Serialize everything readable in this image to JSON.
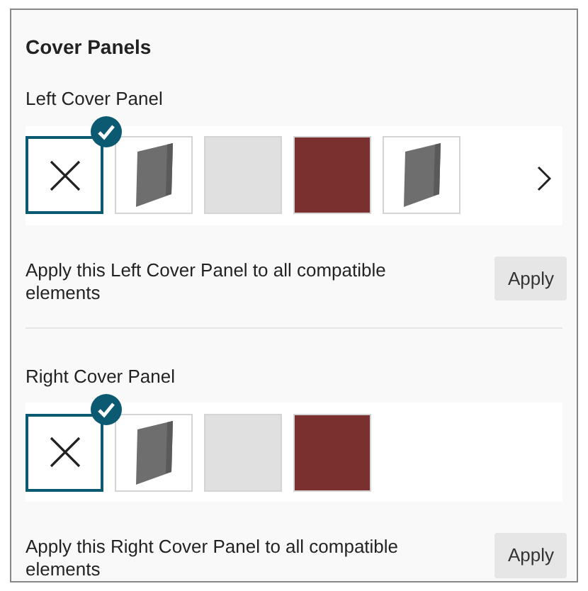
{
  "title": "Cover Panels",
  "sections": [
    {
      "label": "Left Cover Panel",
      "has_next": true,
      "options": [
        {
          "kind": "none",
          "selected": true
        },
        {
          "kind": "panel",
          "selected": false
        },
        {
          "kind": "color",
          "color": "#e0e0e0",
          "selected": false
        },
        {
          "kind": "color",
          "color": "#7b3030",
          "selected": false
        },
        {
          "kind": "panel",
          "selected": false
        }
      ],
      "apply_text": "Apply this Left Cover Panel to all compatible elements",
      "apply_button": "Apply"
    },
    {
      "label": "Right Cover Panel",
      "has_next": false,
      "options": [
        {
          "kind": "none",
          "selected": true
        },
        {
          "kind": "panel",
          "selected": false
        },
        {
          "kind": "color",
          "color": "#e0e0e0",
          "selected": false
        },
        {
          "kind": "color",
          "color": "#7b3030",
          "selected": false
        }
      ],
      "apply_text": "Apply this Right Cover Panel to all compatible elements",
      "apply_button": "Apply"
    }
  ]
}
